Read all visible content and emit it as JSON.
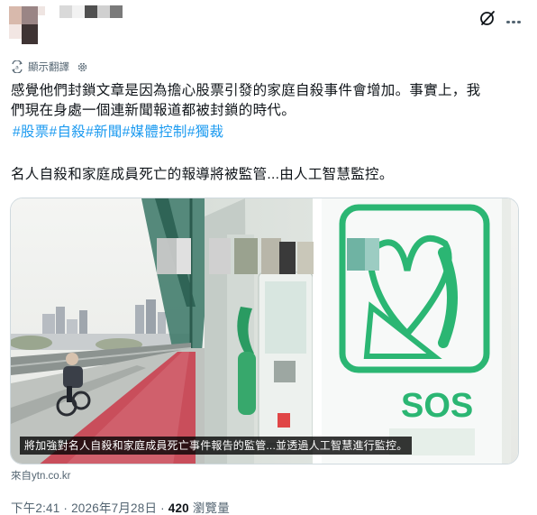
{
  "header": {
    "more_icon": "more-icon",
    "grok_icon": "grok-icon"
  },
  "translate": {
    "label": "顯示翻譯",
    "icon": "translate-icon",
    "settings_icon": "gear-icon"
  },
  "post": {
    "text_line1": "感覺他們封鎖文章是因為擔心股票引發的家庭自殺事件會增加。事實上，我",
    "text_line2": "們現在身處一個連新聞報道都被封鎖的時代。",
    "hashtags": [
      "#股票",
      "#自殺",
      "#新聞",
      "#媒體控制",
      "#獨裁"
    ],
    "text2": "名人自殺和家庭成員死亡的報導將被監管...由人工智慧監控。"
  },
  "card": {
    "sign_text": "SOS",
    "caption": "將加強對名人自殺和家庭成員死亡事件報告的監管...並透過人工智慧進行監控。",
    "source": "來自ytn.co.kr"
  },
  "meta": {
    "time": "下午2:41",
    "sep1": " · ",
    "date": "2026年7月28日",
    "sep2": " · ",
    "views_count": "420",
    "views_label": " 瀏覽量"
  },
  "colors": {
    "link": "#1d9bf0",
    "secondary_text": "#536471",
    "sign_green": "#2bb673"
  }
}
